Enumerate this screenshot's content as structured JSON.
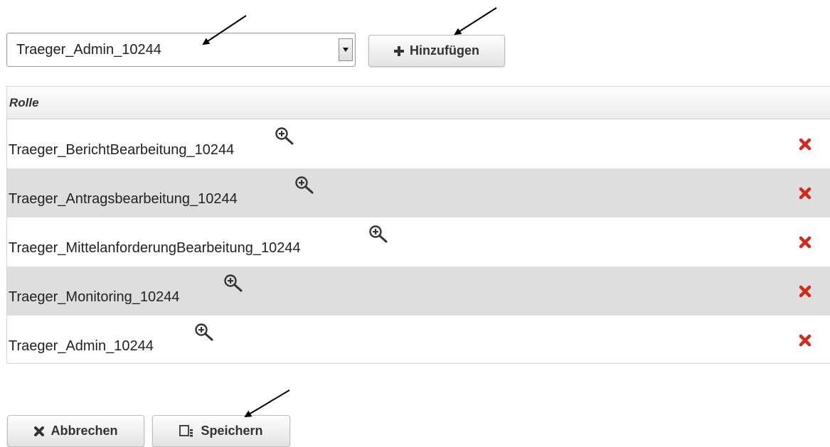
{
  "role_picker": {
    "selected_value": "Traeger_Admin_10244",
    "add_label": "Hinzufügen"
  },
  "table": {
    "header": "Rolle",
    "rows": [
      {
        "name": "Traeger_BerichtBearbeitung_10244"
      },
      {
        "name": "Traeger_Antragsbearbeitung_10244"
      },
      {
        "name": "Traeger_MittelanforderungBearbeitung_10244"
      },
      {
        "name": "Traeger_Monitoring_10244"
      },
      {
        "name": "Traeger_Admin_10244"
      }
    ]
  },
  "actions": {
    "cancel_label": "Abbrechen",
    "save_label": "Speichern"
  },
  "icons": {
    "add": "plus-icon",
    "detail": "zoom-in-icon",
    "delete": "red-x-icon",
    "cancel": "x-icon",
    "save": "save-icon"
  },
  "colors": {
    "delete_red": "#d42a1e",
    "row_shade": "#dedede"
  }
}
